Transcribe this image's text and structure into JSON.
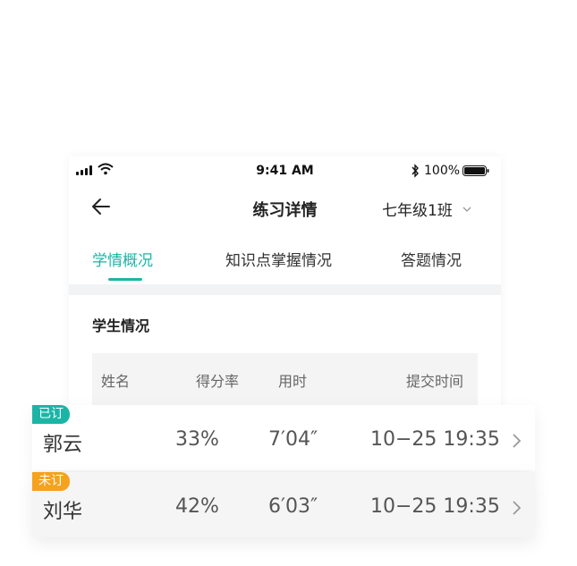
{
  "status_bar": {
    "time": "9:41 AM",
    "battery_percent": "100%",
    "icons": [
      "signal-icon",
      "wifi-icon",
      "bluetooth-icon",
      "battery-icon"
    ]
  },
  "nav": {
    "title": "练习详情",
    "class_selector": "七年级1班",
    "back_icon": "arrow-left-icon",
    "dropdown_icon": "chevron-down-icon"
  },
  "tabs": [
    {
      "label": "学情概况",
      "active": true
    },
    {
      "label": "知识点掌握情况",
      "active": false
    },
    {
      "label": "答题情况",
      "active": false
    }
  ],
  "section": {
    "title": "学生情况"
  },
  "table": {
    "headers": [
      "姓名",
      "得分率",
      "用时",
      "提交时间"
    ],
    "rows": [
      {
        "badge": "已订",
        "name": "郭云",
        "score_rate": "33%",
        "duration": "7′04″",
        "submit_time": "10−25 19:35"
      },
      {
        "badge": "未订",
        "name": "刘华",
        "score_rate": "42%",
        "duration": "6′03″",
        "submit_time": "10−25 19:35"
      }
    ]
  },
  "colors": {
    "accent": "#1bb5a6",
    "badge_done": "#1bb5a6",
    "badge_pending": "#f5a21e",
    "header_bg": "#f4f4f5"
  }
}
